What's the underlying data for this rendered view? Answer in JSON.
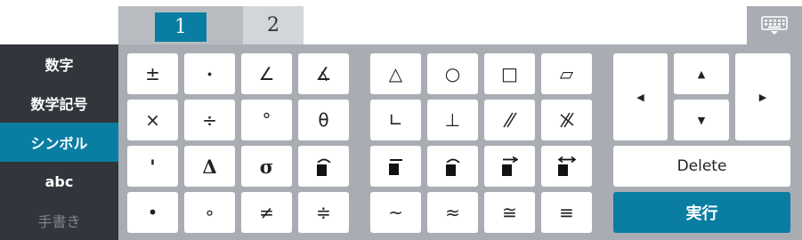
{
  "tabs": [
    {
      "label": "1",
      "active": true
    },
    {
      "label": "2",
      "active": false
    }
  ],
  "keyboard_toggle_icon": "keyboard-icon",
  "sidebar": {
    "items": [
      {
        "label": "数字",
        "active": false
      },
      {
        "label": "数学記号",
        "active": false
      },
      {
        "label": "シンボル",
        "active": true
      },
      {
        "label": "abc",
        "active": false
      },
      {
        "label": "手書き",
        "active": false,
        "disabled": true
      }
    ]
  },
  "symbols": {
    "row1": [
      "±",
      "·",
      "∠",
      "∡"
    ],
    "row2": [
      "×",
      "÷",
      "°",
      "θ"
    ],
    "row3": [
      "'",
      "Δ",
      "σ"
    ],
    "row4": [
      "•",
      "∘",
      "≠",
      "≑"
    ],
    "shapes": [
      "△",
      "○",
      "□",
      "▱"
    ],
    "row2b": [
      "∟",
      "⊥",
      "//",
      "⫽"
    ],
    "row4b": [
      "~",
      "≈",
      "≅",
      "≡"
    ]
  },
  "arrows": {
    "up": "▲",
    "down": "▼",
    "left": "◀",
    "right": "▶"
  },
  "actions": {
    "delete_label": "Delete",
    "execute_label": "実行"
  },
  "colors": {
    "accent": "#0a7ea2",
    "sidebar_bg": "#32363c",
    "panel_bg": "#a9adb3"
  }
}
